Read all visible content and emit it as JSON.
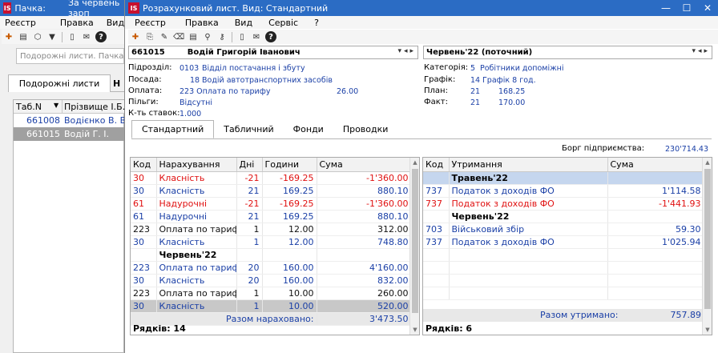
{
  "back_window": {
    "title": "Пачка:",
    "title2": "За червень зарп",
    "menu": [
      "Реєстр",
      "Правка",
      "Вид"
    ],
    "search_placeholder": "Подорожні листи. Пачка зарп",
    "tabs": [
      "Подорожні листи",
      "Н"
    ],
    "columns": [
      "Таб.N",
      "Прізвище І.Б."
    ],
    "rows": [
      {
        "tab": "661008",
        "name": "Водієнко В. В."
      },
      {
        "tab": "661015",
        "name": "Водій Г. І."
      }
    ]
  },
  "window": {
    "title": "Розрахунковий лист. Вид: Стандартний",
    "menu": [
      "Реєстр",
      "Правка",
      "Вид",
      "Сервіс",
      "?"
    ]
  },
  "employee": {
    "id": "661015",
    "name": "Водій Григорій Іванович",
    "period": "Червень'22 (поточний)"
  },
  "info": {
    "labels": {
      "dept": "Підрозділ:",
      "position": "Посада:",
      "pay": "Оплата:",
      "benefits": "Пільги:",
      "rates": "К-ть ставок:",
      "category": "Категорія:",
      "schedule": "Графік:",
      "plan": "План:",
      "fact": "Факт:"
    },
    "dept_code": "0103",
    "dept_name": "Відділ постачання і збуту",
    "position_code": "18",
    "position_name": "Водій автотранспортних засобів",
    "pay_text": "223 Оплата по тарифу",
    "pay_rate": "26.00",
    "benefits": "Відсутні",
    "rates": "1.000",
    "category_code": "5",
    "category_name": "Робітники допоміжні",
    "schedule_code": "14",
    "schedule_name": "Графік 8 год.",
    "plan_days": "21",
    "plan_hours": "168.25",
    "fact_days": "21",
    "fact_hours": "170.00"
  },
  "tabs": [
    "Стандартний",
    "Табличний",
    "Фонди",
    "Проводки"
  ],
  "debt": {
    "label": "Борг підприємства:",
    "value": "230'714.43"
  },
  "accruals": {
    "columns": [
      "Код",
      "Нарахування",
      "Дні",
      "Години",
      "Сума"
    ],
    "rows": [
      {
        "code": "30",
        "name": "Класність",
        "days": "-21",
        "hours": "-169.25",
        "sum": "-1'360.00",
        "style": "red"
      },
      {
        "code": "30",
        "name": "Класність",
        "days": "21",
        "hours": "169.25",
        "sum": "880.10",
        "style": "blue"
      },
      {
        "code": "61",
        "name": "Надурочні",
        "days": "-21",
        "hours": "-169.25",
        "sum": "-1'360.00",
        "style": "red"
      },
      {
        "code": "61",
        "name": "Надурочні",
        "days": "21",
        "hours": "169.25",
        "sum": "880.10",
        "style": "blue"
      },
      {
        "code": "223",
        "name": "Оплата по тарифу",
        "days": "1",
        "hours": "12.00",
        "sum": "312.00",
        "style": "black"
      },
      {
        "code": "30",
        "name": "Класність",
        "days": "1",
        "hours": "12.00",
        "sum": "748.80",
        "style": "blue"
      },
      {
        "code": "",
        "name": "Червень'22",
        "days": "",
        "hours": "",
        "sum": "",
        "style": "hdr"
      },
      {
        "code": "223",
        "name": "Оплата по тарифу",
        "days": "20",
        "hours": "160.00",
        "sum": "4'160.00",
        "style": "blue"
      },
      {
        "code": "30",
        "name": "Класність",
        "days": "20",
        "hours": "160.00",
        "sum": "832.00",
        "style": "blue"
      },
      {
        "code": "223",
        "name": "Оплата по тарифу",
        "days": "1",
        "hours": "10.00",
        "sum": "260.00",
        "style": "black"
      },
      {
        "code": "30",
        "name": "Класність",
        "days": "1",
        "hours": "10.00",
        "sum": "520.00",
        "style": "blue sel"
      }
    ],
    "total_label": "Разом нараховано:",
    "total_value": "3'473.50",
    "rows_label": "Рядків: 14"
  },
  "deductions": {
    "columns": [
      "Код",
      "Утримання",
      "Сума"
    ],
    "rows": [
      {
        "code": "",
        "name": "Травень'22",
        "sum": "",
        "style": "hdr hl"
      },
      {
        "code": "737",
        "name": "Податок з доходів ФО",
        "sum": "1'114.58",
        "style": "blue"
      },
      {
        "code": "737",
        "name": "Податок з доходів ФО",
        "sum": "-1'441.93",
        "style": "red"
      },
      {
        "code": "",
        "name": "Червень'22",
        "sum": "",
        "style": "hdr"
      },
      {
        "code": "703",
        "name": "Військовий збір",
        "sum": "59.30",
        "style": "blue"
      },
      {
        "code": "737",
        "name": "Податок з доходів ФО",
        "sum": "1'025.94",
        "style": "blue"
      }
    ],
    "total_label": "Разом утримано:",
    "total_value": "757.89",
    "rows_label": "Рядків: 6"
  }
}
